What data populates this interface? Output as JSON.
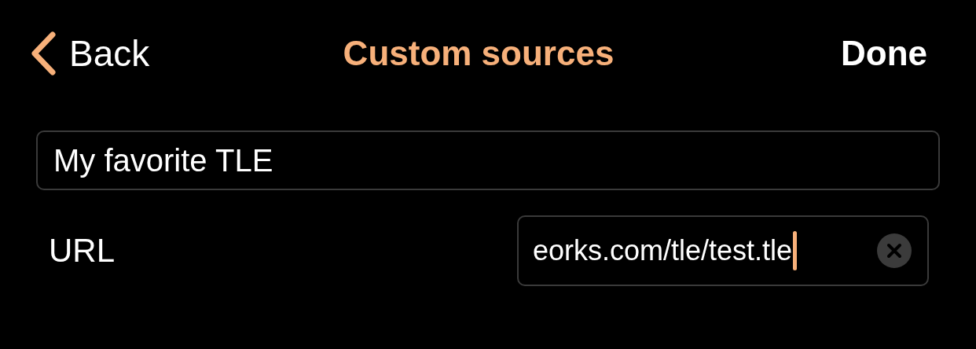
{
  "nav": {
    "back": "Back",
    "title": "Custom sources",
    "done": "Done"
  },
  "name_field": {
    "value": "My favorite TLE"
  },
  "url_row": {
    "label": "URL",
    "value": "eorks.com/tle/test.tle",
    "focused": true
  }
}
